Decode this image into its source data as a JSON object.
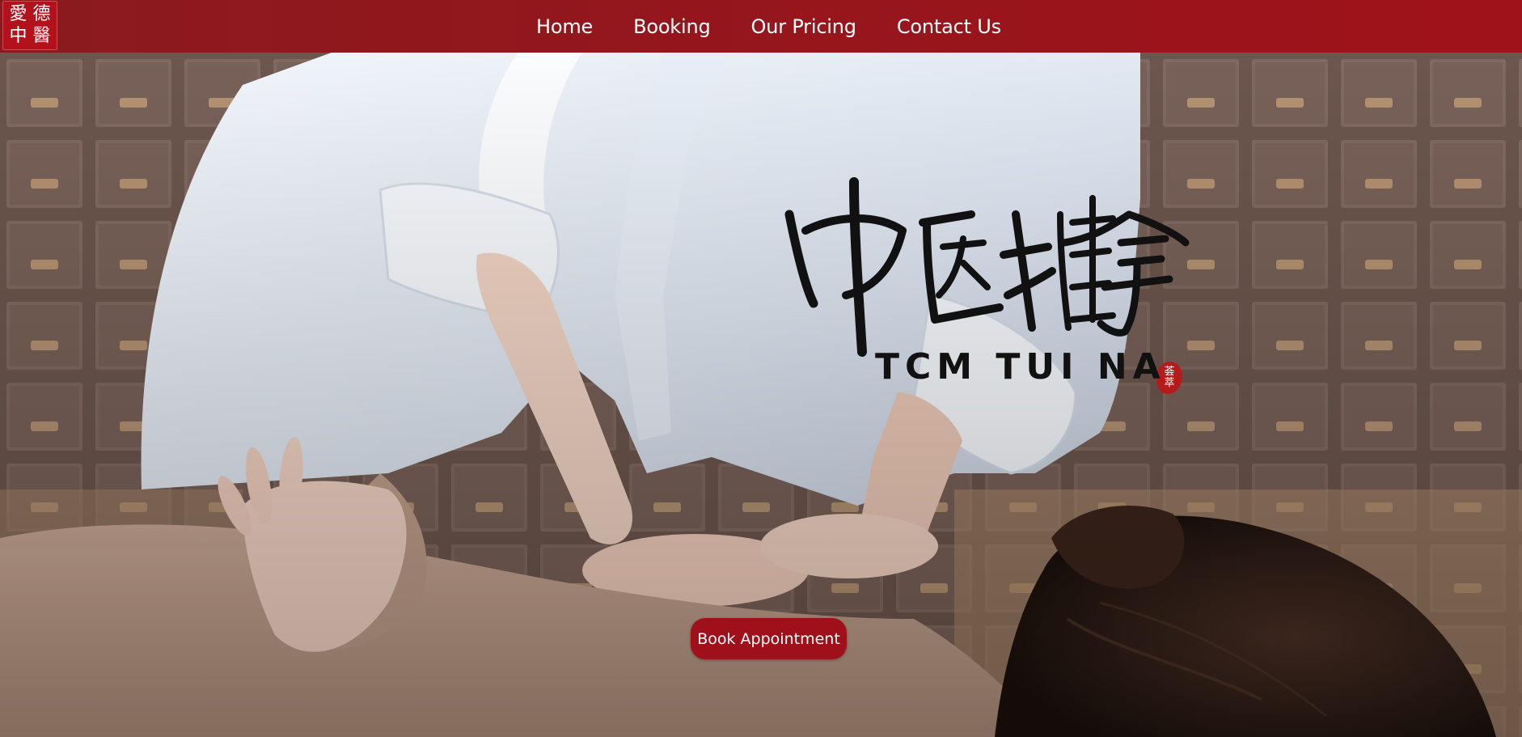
{
  "logo": {
    "chars": [
      "愛",
      "德",
      "中",
      "醫"
    ]
  },
  "nav": {
    "items": [
      {
        "label": "Home"
      },
      {
        "label": "Booking"
      },
      {
        "label": "Our Pricing"
      },
      {
        "label": "Contact Us"
      }
    ]
  },
  "hero": {
    "title_cn": "中医推拿",
    "title_en": "TCM TUI NA",
    "seal_chars": [
      "荟",
      "萃"
    ],
    "cta_label": "Book Appointment"
  },
  "colors": {
    "nav_bg": "#9a1219",
    "accent": "#a0101a",
    "title_text": "#111111",
    "nav_text": "#ffffff"
  }
}
